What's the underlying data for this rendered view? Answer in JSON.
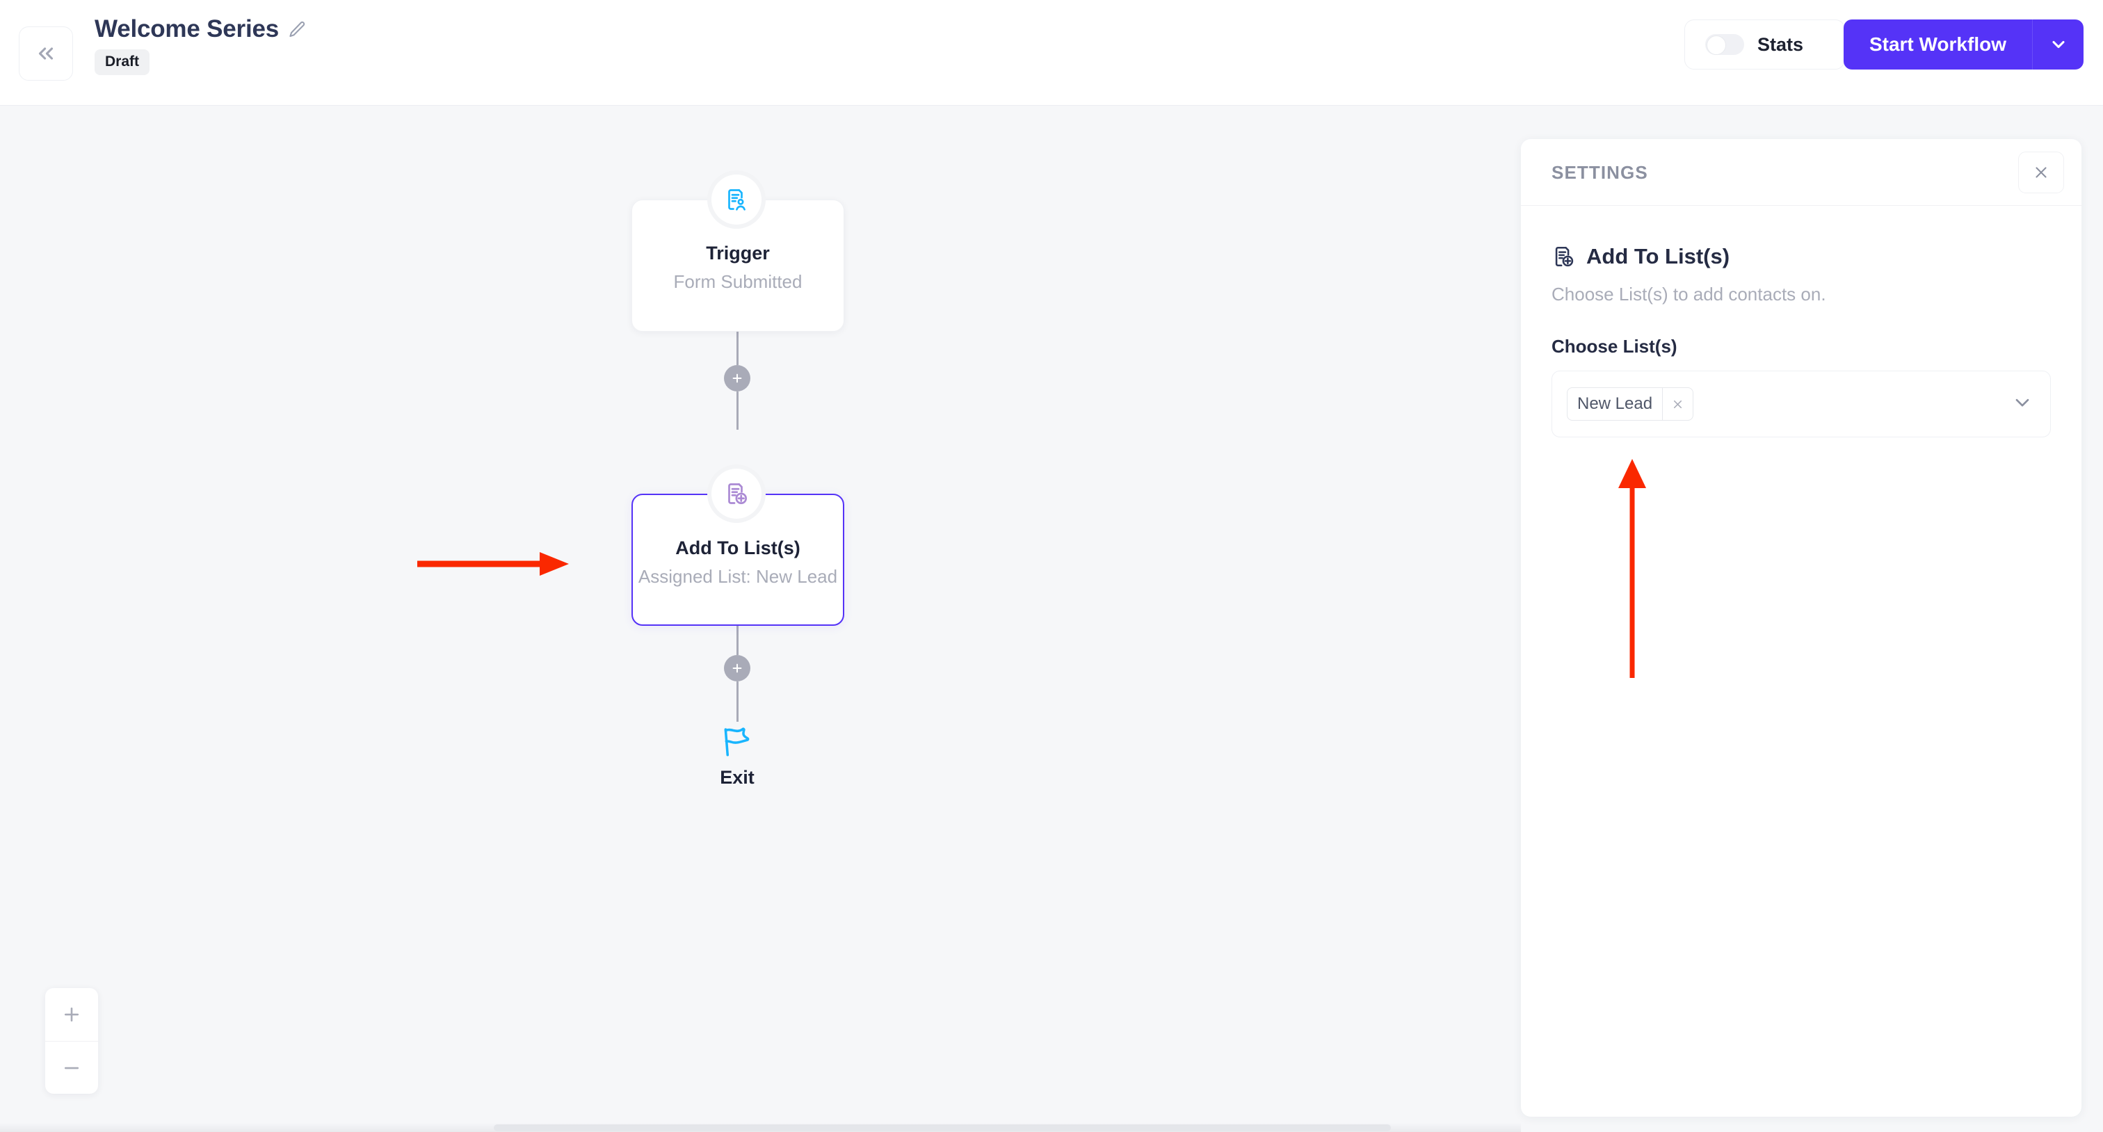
{
  "header": {
    "collapse_icon": "chevron-double-left-icon",
    "workflow_title": "Welcome Series",
    "edit_icon": "pencil-icon",
    "status_badge": "Draft",
    "stats_toggle_label": "Stats",
    "stats_toggle_state": "off",
    "start_button_label": "Start Workflow",
    "start_button_caret_icon": "chevron-down-icon",
    "accent_color": "#5533f7"
  },
  "canvas": {
    "background_color": "#f6f7f9",
    "nodes": [
      {
        "id": "trigger",
        "icon": "form-submitted-icon",
        "icon_color": "#19b5fe",
        "title": "Trigger",
        "subtitle": "Form Submitted",
        "selected": false
      },
      {
        "id": "add-to-lists",
        "icon": "add-to-list-icon",
        "icon_color": "#ab8ad4",
        "title": "Add To List(s)",
        "subtitle": "Assigned List: New Lead",
        "selected": true
      }
    ],
    "add_step_buttons": [
      {
        "id": "add-step-1",
        "icon": "plus-icon"
      },
      {
        "id": "add-step-2",
        "icon": "plus-icon"
      }
    ],
    "exit": {
      "icon": "flag-icon",
      "icon_color": "#19b5fe",
      "label": "Exit"
    },
    "zoom_controls": {
      "zoom_in_icon": "plus-icon",
      "zoom_out_icon": "minus-icon"
    }
  },
  "settings": {
    "panel_title": "SETTINGS",
    "close_icon": "close-icon",
    "heading_icon": "add-to-list-icon",
    "heading": "Add To List(s)",
    "description": "Choose List(s) to add contacts on.",
    "field_label": "Choose List(s)",
    "select": {
      "placeholder": "",
      "caret_icon": "chevron-down-icon",
      "tags": [
        {
          "label": "New Lead",
          "remove_icon": "close-icon"
        }
      ]
    }
  },
  "annotations": {
    "color": "#fa2800",
    "arrows": [
      {
        "id": "arrow-to-node",
        "direction": "right"
      },
      {
        "id": "arrow-to-tag",
        "direction": "up"
      }
    ]
  }
}
